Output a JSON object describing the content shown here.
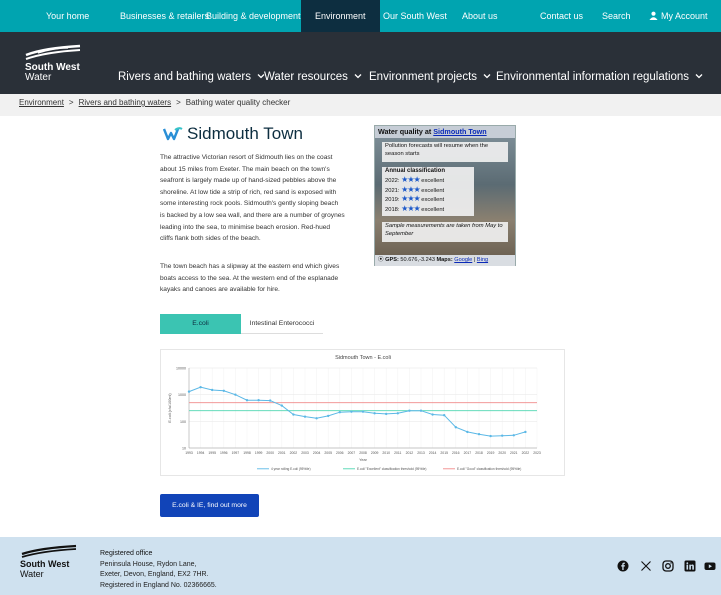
{
  "topnav": {
    "items": [
      "Your home",
      "Businesses & retailers",
      "Building & development",
      "Environment",
      "Our South West",
      "About us",
      "Contact us",
      "Search",
      "My Account"
    ]
  },
  "brand": {
    "line1": "South West",
    "line2": "Water"
  },
  "mainnav": {
    "items": [
      "Rivers and bathing waters",
      "Water resources",
      "Environment projects",
      "Environmental information regulations"
    ]
  },
  "breadcrumb": {
    "crumb1": "Environment",
    "crumb2": "Rivers and bathing waters",
    "current": "Bathing water quality checker",
    "sep": ">"
  },
  "page": {
    "title": "Sidmouth Town",
    "para1_lines": [
      "The attractive Victorian resort of Sidmouth lies on the coast",
      "about 15 miles from Exeter. The main beach on the town's",
      "seafront is largely made up of hand-sized pebbles above the",
      "shoreline. At low tide a strip of rich, red sand is exposed with",
      "some interesting rock pools. Sidmouth's gently sloping beach",
      "is backed by a low sea wall, and there are a number of groynes",
      "leading into the sea, to minimise beach erosion. Red-hued",
      "cliffs flank both sides of the beach."
    ],
    "para2_lines": [
      "The town beach has a slipway at the eastern end which gives",
      "boats access to the sea. At the western end of the esplanade",
      "kayaks and canoes are available for hire."
    ]
  },
  "water_quality": {
    "heading_prefix": "Water quality at",
    "heading_link": "Sidmouth Town",
    "forecast_note": "Pollution forecasts will resume when the season starts",
    "classification_title": "Annual classification",
    "classifications": [
      {
        "year": "2022:",
        "stars": "★★★",
        "rating": "excellent"
      },
      {
        "year": "2021:",
        "stars": "★★★",
        "rating": "excellent"
      },
      {
        "year": "2019:",
        "stars": "★★★",
        "rating": "excellent"
      },
      {
        "year": "2018:",
        "stars": "★★★",
        "rating": "excellent"
      }
    ],
    "sample_note": "Sample measurements are taken from May to September",
    "gps_label": "GPS:",
    "gps_value": "50.676,-3.243",
    "maps_label": "Maps:",
    "map_google": "Google",
    "map_bing": "Bing",
    "map_sep": "|"
  },
  "tabs": [
    "E.coli",
    "Intestinal Enterococci"
  ],
  "chart_data": {
    "type": "line",
    "title": "Sidmouth Town - E.coli",
    "xlabel": "Year",
    "ylabel": "E.coli (cfu/100ml)",
    "y_scale": "log",
    "ylim": [
      10,
      10000
    ],
    "y_ticks": [
      "10",
      "100",
      "1000",
      "10000"
    ],
    "categories": [
      "1993",
      "1994",
      "1995",
      "1996",
      "1997",
      "1998",
      "1999",
      "2000",
      "2001",
      "2002",
      "2003",
      "2004",
      "2005",
      "2006",
      "2007",
      "2008",
      "2009",
      "2010",
      "2011",
      "2012",
      "2013",
      "2014",
      "2015",
      "2016",
      "2017",
      "2018",
      "2019",
      "2020",
      "2021",
      "2022",
      "2023"
    ],
    "series": [
      {
        "name": "4 year rolling E.coli (95%ile)",
        "color": "#5bb8e6",
        "values": [
          1300,
          1900,
          1500,
          1400,
          1000,
          620,
          620,
          600,
          390,
          180,
          150,
          130,
          160,
          220,
          230,
          230,
          200,
          190,
          200,
          250,
          250,
          180,
          170,
          60,
          40,
          33,
          28,
          29,
          30,
          40,
          null
        ]
      },
      {
        "name": "E.coli \"Excellent\" classification threshold (95%ile)",
        "color": "#4fd6b0",
        "values": [
          250,
          250,
          250,
          250,
          250,
          250,
          250,
          250,
          250,
          250,
          250,
          250,
          250,
          250,
          250,
          250,
          250,
          250,
          250,
          250,
          250,
          250,
          250,
          250,
          250,
          250,
          250,
          250,
          250,
          250,
          250
        ]
      },
      {
        "name": "E.coli \"Good\" classification threshold (95%ile)",
        "color": "#f08a8a",
        "values": [
          500,
          500,
          500,
          500,
          500,
          500,
          500,
          500,
          500,
          500,
          500,
          500,
          500,
          500,
          500,
          500,
          500,
          500,
          500,
          500,
          500,
          500,
          500,
          500,
          500,
          500,
          500,
          500,
          500,
          500,
          500
        ]
      }
    ],
    "legend": "bottom",
    "grid": true
  },
  "cta": {
    "label": "E.coli & IE, find out more"
  },
  "footer": {
    "heading": "Registered office",
    "lines": [
      "Peninsula House, Rydon Lane,",
      "Exeter, Devon, England, EX2 7HR.",
      "Registered in England No. 02366665."
    ],
    "social": [
      "facebook-icon",
      "x-icon",
      "instagram-icon",
      "linkedin-icon",
      "youtube-icon"
    ]
  }
}
